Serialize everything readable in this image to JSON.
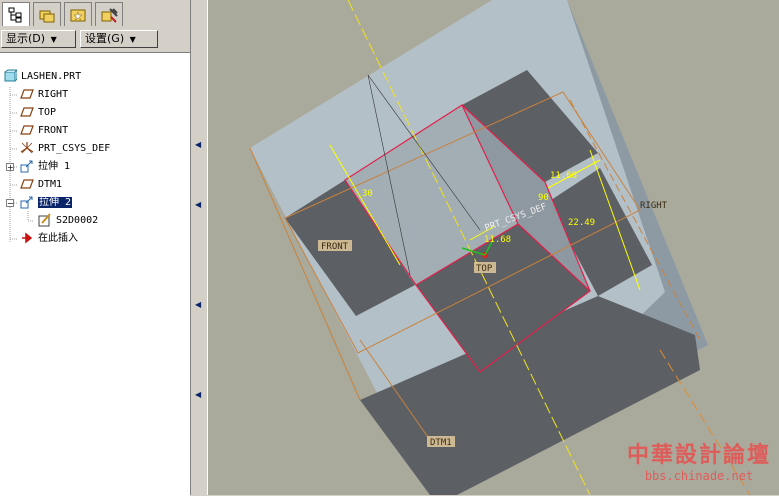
{
  "toolbar": {
    "tabs": [
      {
        "icon": "model-tree-icon",
        "active": true
      },
      {
        "icon": "folder-browser-icon",
        "active": false
      },
      {
        "icon": "favorites-icon",
        "active": false
      },
      {
        "icon": "connections-icon",
        "active": false
      }
    ],
    "show_label": "显示(D)",
    "settings_label": "设置(G)"
  },
  "tree": {
    "root": "LASHEN.PRT",
    "items": [
      {
        "label": "RIGHT",
        "icon": "datum-plane-icon"
      },
      {
        "label": "TOP",
        "icon": "datum-plane-icon"
      },
      {
        "label": "FRONT",
        "icon": "datum-plane-icon"
      },
      {
        "label": "PRT_CSYS_DEF",
        "icon": "coordinate-system-icon"
      },
      {
        "label": "拉伸 1",
        "icon": "extrude-icon"
      },
      {
        "label": "DTM1",
        "icon": "datum-plane-icon"
      },
      {
        "label": "拉伸 2",
        "icon": "extrude-icon",
        "selected": true
      },
      {
        "label": "S2D0002",
        "icon": "sketch-icon"
      },
      {
        "label": "在此插入",
        "icon": "insert-here-icon"
      }
    ]
  },
  "viewport": {
    "datum_labels": {
      "right": "RIGHT",
      "front": "FRONT",
      "top": "TOP",
      "dtm1": "DTM1",
      "csys": "PRT_CSYS_DEF"
    },
    "dimensions": {
      "d1": "30",
      "d2": "11.68",
      "d3": "22.49",
      "d4": "11.68",
      "d5": "90"
    },
    "colors": {
      "face_light": "#b4c0c8",
      "face_dark": "#5c5f63",
      "sketch_edge": "#e0204a",
      "dim": "#ffff00",
      "datum": "#c8823c"
    }
  },
  "watermark": {
    "title": "中華設計論壇",
    "url": "bbs.chinade.net"
  }
}
